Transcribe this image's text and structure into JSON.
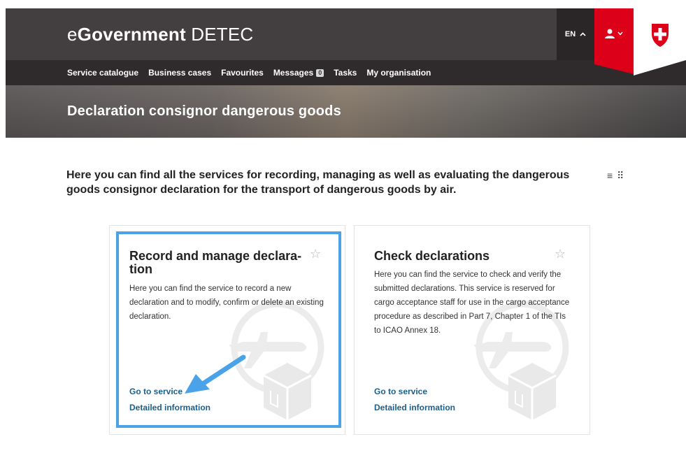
{
  "header": {
    "brand_prefix": "e",
    "brand_bold": "Government",
    "brand_suffix": " DETEC",
    "language": "EN",
    "language_caret": "^"
  },
  "nav": {
    "items": [
      {
        "label": "Service catalogue"
      },
      {
        "label": "Business cases"
      },
      {
        "label": "Favourites"
      },
      {
        "label": "Messages",
        "badge": "0"
      },
      {
        "label": "Tasks"
      },
      {
        "label": "My organisation"
      }
    ]
  },
  "hero": {
    "title": "Declaration consignor dangerous goods"
  },
  "intro": {
    "text": "Here you can find all the services for recording, managing as well as evaluating the dangerous goods consignor declaration for the transport of dangerous goods by air."
  },
  "view_toggle": {
    "list_glyph": "≡",
    "grid_glyph": "⠿"
  },
  "cards": [
    {
      "title": "Record and manage declara-tion",
      "star": "☆",
      "description": "Here you can find the service to record a new declaration and to modify, confirm or delete an existing declaration.",
      "go_to_service": "Go to service",
      "detailed_information": "Detailed information",
      "icon": "airplane-package-icon"
    },
    {
      "title": "Check declarations",
      "star": "☆",
      "description": "Here you can find the service to check and verify the submitted declarations. This service is reserved for cargo acceptance staff for use in the cargo acceptance procedure as described in Part 7, Chapter 1 of the TIs to ICAO Annex 18.",
      "go_to_service": "Go to service",
      "detailed_information": "Detailed information",
      "icon": "airplane-package-icon"
    }
  ],
  "colors": {
    "header_bg": "#433e40",
    "nav_bg": "#2f2b2c",
    "swiss_red": "#dc0018",
    "link": "#1b5f8c",
    "highlight": "#4aa3e8"
  }
}
